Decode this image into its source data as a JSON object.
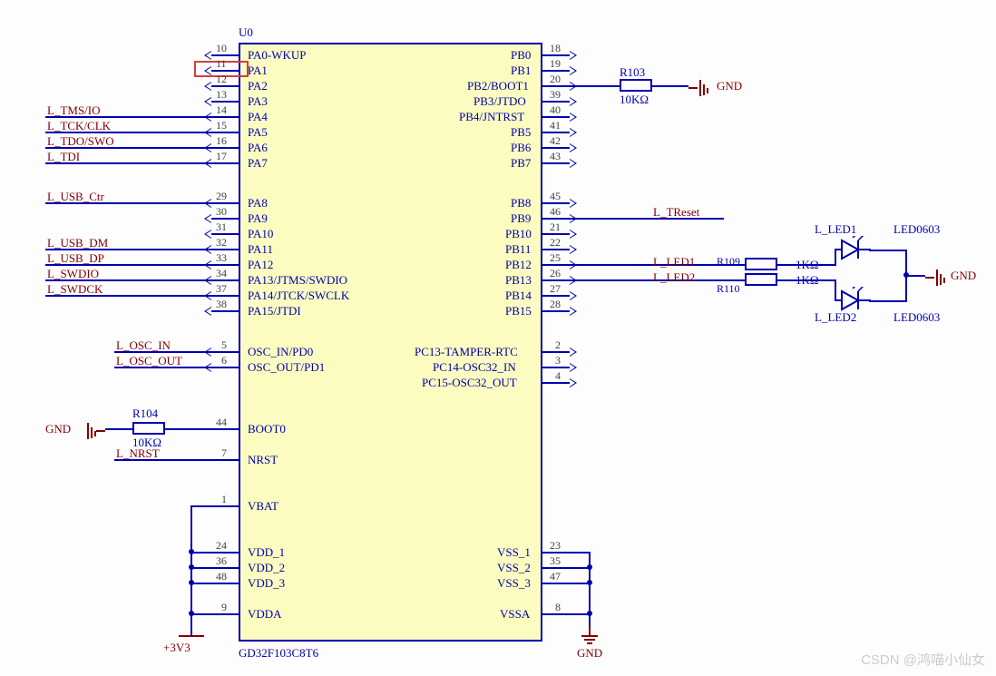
{
  "chip": {
    "refdes": "U0",
    "part": "GD32F103C8T6",
    "left_pins": [
      {
        "num": "10",
        "label": "PA0-WKUP",
        "net": ""
      },
      {
        "num": "11",
        "label": "PA1",
        "net": ""
      },
      {
        "num": "12",
        "label": "PA2",
        "net": ""
      },
      {
        "num": "13",
        "label": "PA3",
        "net": ""
      },
      {
        "num": "14",
        "label": "PA4",
        "net": "L_TMS/IO"
      },
      {
        "num": "15",
        "label": "PA5",
        "net": "L_TCK/CLK"
      },
      {
        "num": "16",
        "label": "PA6",
        "net": "L_TDO/SWO"
      },
      {
        "num": "17",
        "label": "PA7",
        "net": "L_TDI"
      },
      {
        "num": "29",
        "label": "PA8",
        "net": "L_USB_Ctr"
      },
      {
        "num": "30",
        "label": "PA9",
        "net": ""
      },
      {
        "num": "31",
        "label": "PA10",
        "net": ""
      },
      {
        "num": "32",
        "label": "PA11",
        "net": "L_USB_DM"
      },
      {
        "num": "33",
        "label": "PA12",
        "net": "L_USB_DP"
      },
      {
        "num": "34",
        "label": "PA13/JTMS/SWDIO",
        "net": "L_SWDIO"
      },
      {
        "num": "37",
        "label": "PA14/JTCK/SWCLK",
        "net": "L_SWDCK"
      },
      {
        "num": "38",
        "label": "PA15/JTDI",
        "net": ""
      },
      {
        "num": "5",
        "label": "OSC_IN/PD0",
        "net": "L_OSC_IN"
      },
      {
        "num": "6",
        "label": "OSC_OUT/PD1",
        "net": "L_OSC_OUT"
      },
      {
        "num": "44",
        "label": "BOOT0",
        "net": ""
      },
      {
        "num": "7",
        "label": "NRST",
        "net": "L_NRST"
      },
      {
        "num": "1",
        "label": "VBAT",
        "net": ""
      },
      {
        "num": "24",
        "label": "VDD_1",
        "net": ""
      },
      {
        "num": "36",
        "label": "VDD_2",
        "net": ""
      },
      {
        "num": "48",
        "label": "VDD_3",
        "net": ""
      },
      {
        "num": "9",
        "label": "VDDA",
        "net": ""
      }
    ],
    "right_pins": [
      {
        "num": "18",
        "label": "PB0",
        "net": ""
      },
      {
        "num": "19",
        "label": "PB1",
        "net": ""
      },
      {
        "num": "20",
        "label": "PB2/BOOT1",
        "net": ""
      },
      {
        "num": "39",
        "label": "PB3/JTDO",
        "net": ""
      },
      {
        "num": "40",
        "label": "PB4/JNTRST",
        "net": ""
      },
      {
        "num": "41",
        "label": "PB5",
        "net": ""
      },
      {
        "num": "42",
        "label": "PB6",
        "net": ""
      },
      {
        "num": "43",
        "label": "PB7",
        "net": ""
      },
      {
        "num": "45",
        "label": "PB8",
        "net": ""
      },
      {
        "num": "46",
        "label": "PB9",
        "net": "L_TReset"
      },
      {
        "num": "21",
        "label": "PB10",
        "net": ""
      },
      {
        "num": "22",
        "label": "PB11",
        "net": ""
      },
      {
        "num": "25",
        "label": "PB12",
        "net": "L_LED1"
      },
      {
        "num": "26",
        "label": "PB13",
        "net": "L_LED2"
      },
      {
        "num": "27",
        "label": "PB14",
        "net": ""
      },
      {
        "num": "28",
        "label": "PB15",
        "net": ""
      },
      {
        "num": "2",
        "label": "PC13-TAMPER-RTC",
        "net": ""
      },
      {
        "num": "3",
        "label": "PC14-OSC32_IN",
        "net": ""
      },
      {
        "num": "4",
        "label": "PC15-OSC32_OUT",
        "net": ""
      },
      {
        "num": "23",
        "label": "VSS_1",
        "net": ""
      },
      {
        "num": "35",
        "label": "VSS_2",
        "net": ""
      },
      {
        "num": "47",
        "label": "VSS_3",
        "net": ""
      },
      {
        "num": "8",
        "label": "VSSA",
        "net": ""
      }
    ]
  },
  "components": {
    "R103": {
      "ref": "R103",
      "value": "10KΩ"
    },
    "R104": {
      "ref": "R104",
      "value": "10KΩ"
    },
    "R109": {
      "ref": "R109",
      "value": "1KΩ"
    },
    "R110": {
      "ref": "R110",
      "value": "1KΩ"
    },
    "LED1": {
      "net": "L_LED1",
      "part": "LED0603"
    },
    "LED2": {
      "net": "L_LED2",
      "part": "LED0603"
    }
  },
  "power": {
    "gnd": "GND",
    "p3v3": "+3V3"
  },
  "watermark": "CSDN @鸿喵小仙女"
}
